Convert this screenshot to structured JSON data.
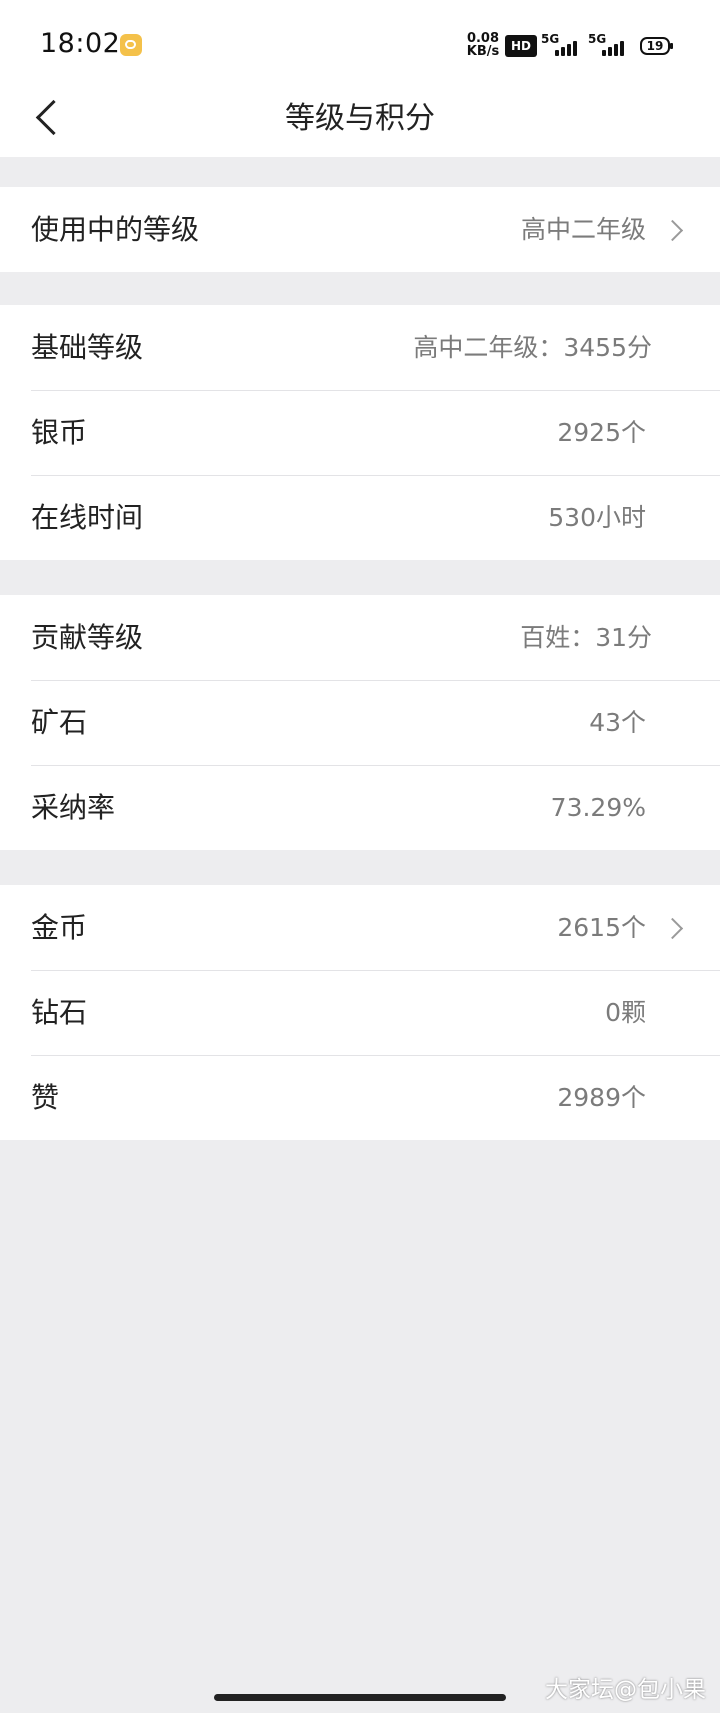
{
  "status_bar": {
    "time": "18:02",
    "net_speed_value": "0.08",
    "net_speed_unit": "KB/s",
    "hd_badge": "HD",
    "sim1_label": "5G",
    "sim2_label": "5G",
    "battery": "19"
  },
  "header": {
    "title": "等级与积分"
  },
  "groups": [
    {
      "rows": [
        {
          "label": "使用中的等级",
          "value": "高中二年级"
        }
      ]
    },
    {
      "rows": [
        {
          "label": "基础等级",
          "value": "高中二年级：3455分"
        },
        {
          "label": "银币",
          "value": "2925个"
        },
        {
          "label": "在线时间",
          "value": "530小时"
        }
      ]
    },
    {
      "rows": [
        {
          "label": "贡献等级",
          "value": "百姓：31分"
        },
        {
          "label": "矿石",
          "value": "43个"
        },
        {
          "label": "采纳率",
          "value": "73.29%"
        }
      ]
    },
    {
      "rows": [
        {
          "label": "金币",
          "value": "2615个"
        },
        {
          "label": "钻石",
          "value": "0颗"
        },
        {
          "label": "赞",
          "value": "2989个"
        }
      ]
    }
  ],
  "watermark": "大家坛@包小果"
}
